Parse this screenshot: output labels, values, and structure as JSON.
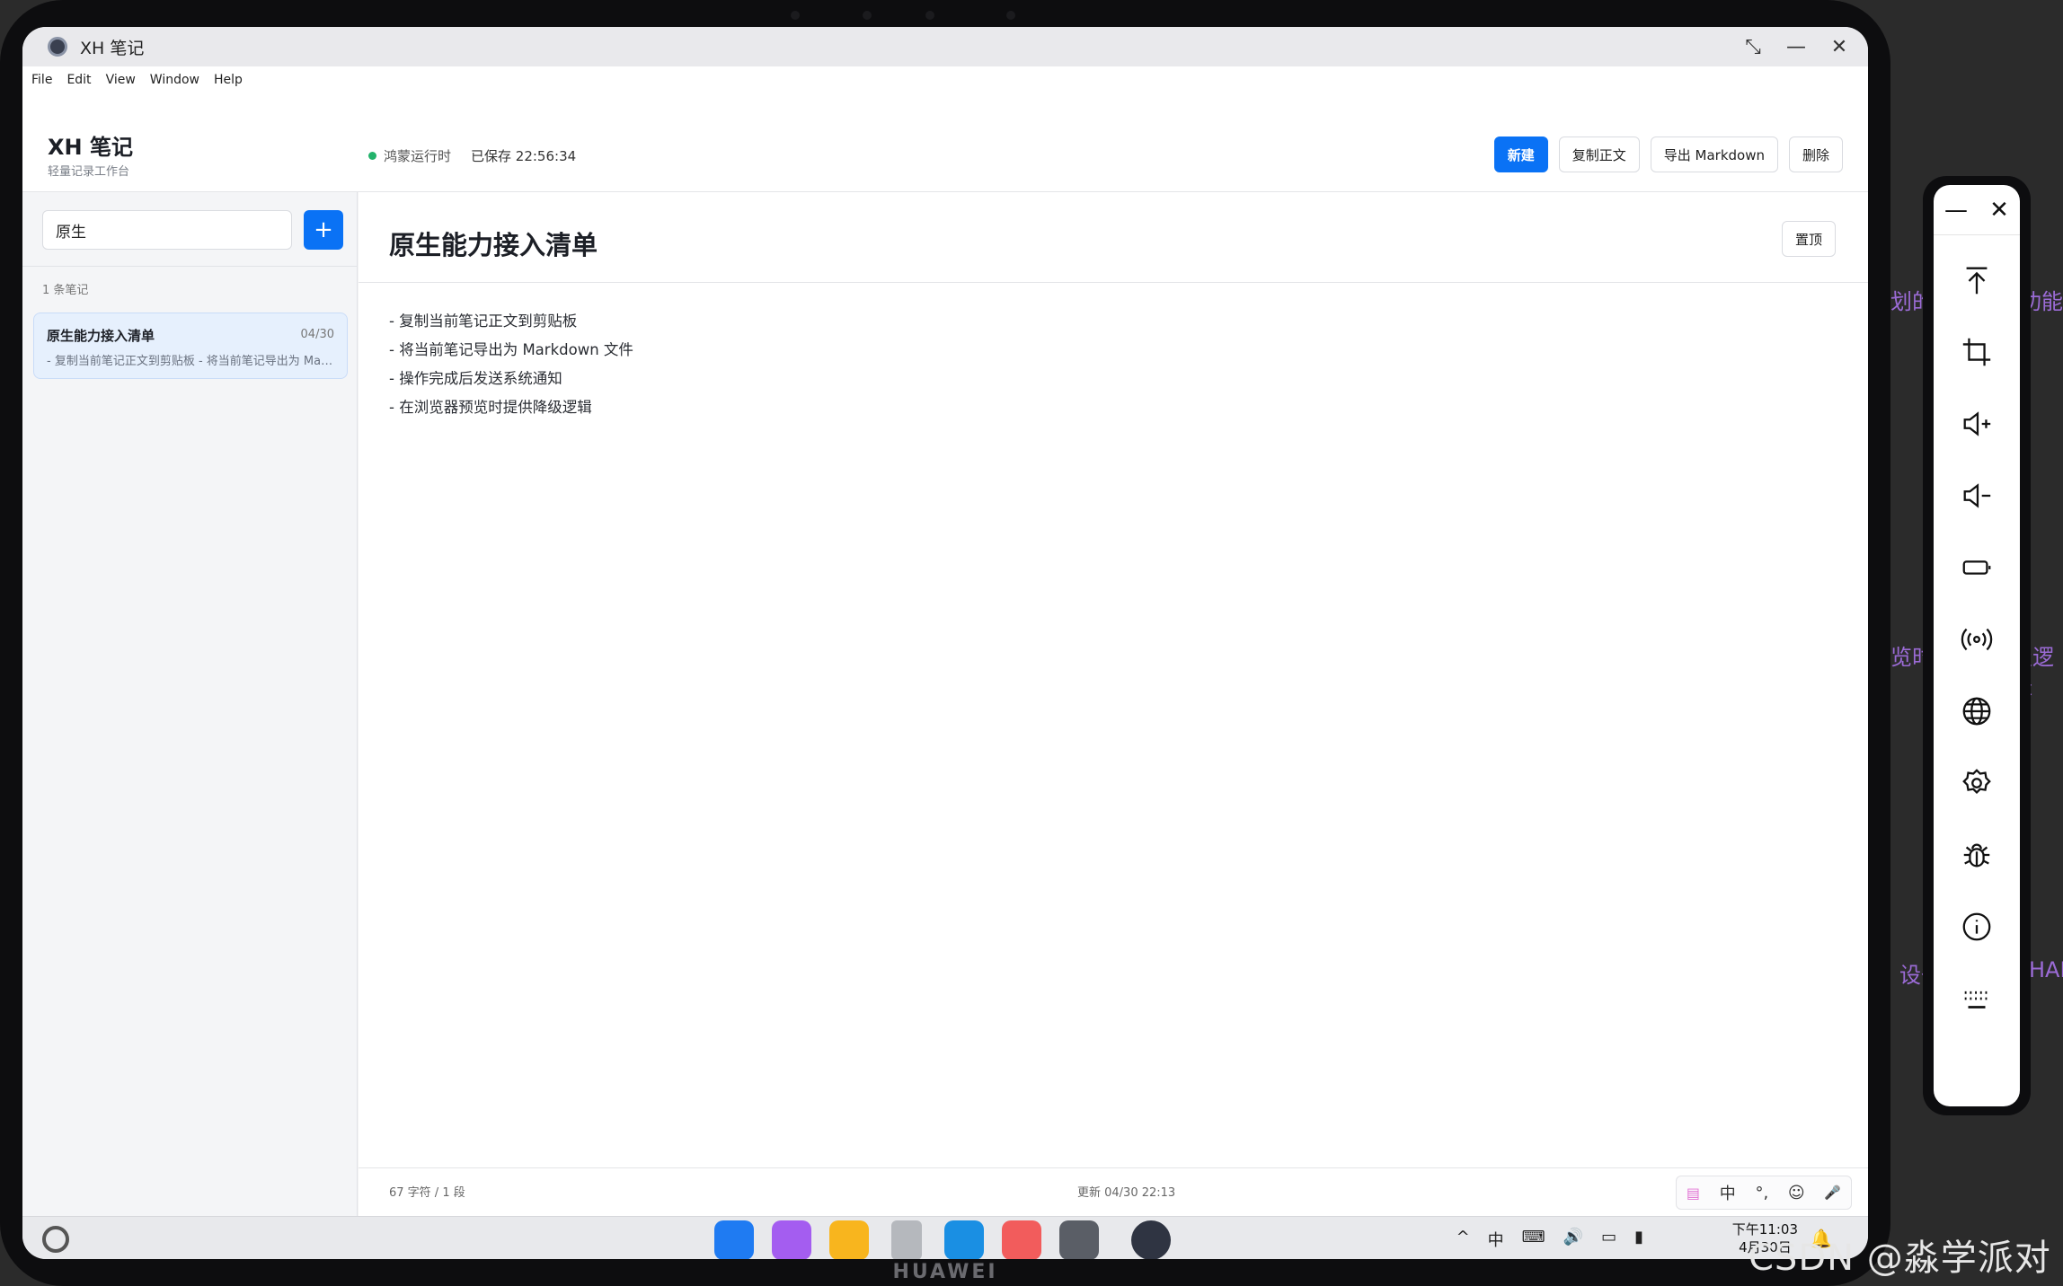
{
  "window": {
    "title": "XH 笔记",
    "controls": [
      "⤡",
      "—",
      "✕"
    ]
  },
  "menu": [
    "File",
    "Edit",
    "View",
    "Window",
    "Help"
  ],
  "header": {
    "app_name": "XH 笔记",
    "app_subtitle": "轻量记录工作台",
    "status": "鸿蒙运行时",
    "saved": "已保存 22:56:34",
    "actions": {
      "new": "新建",
      "copy": "复制正文",
      "export": "导出 Markdown",
      "delete": "删除"
    }
  },
  "sidebar": {
    "search_value": "原生",
    "add_label": "+",
    "count": "1 条笔记",
    "notes": [
      {
        "title": "原生能力接入清单",
        "date": "04/30",
        "snippet": "- 复制当前笔记正文到剪贴板 - 将当前笔记导出为 Markdown 文件"
      }
    ]
  },
  "editor": {
    "title": "原生能力接入清单",
    "pin_label": "置顶",
    "lines": [
      "- 复制当前笔记正文到剪贴板",
      "- 将当前笔记导出为 Markdown 文件",
      "- 操作完成后发送系统通知",
      "- 在浏览器预览时提供降级逻辑"
    ],
    "stats": "67 字符 / 1 段",
    "updated": "更新 04/30 22:13",
    "ime": [
      "中",
      "°,",
      "☺",
      "🎤"
    ]
  },
  "taskbar": {
    "dock": [
      {
        "name": "app-grid-icon",
        "color": "#1f7bf2"
      },
      {
        "name": "multitask-icon",
        "color": "#a45df0"
      },
      {
        "name": "files-icon",
        "color": "#f8b51e"
      },
      {
        "name": "trash-icon",
        "color": "#b5b8bd"
      },
      {
        "name": "browser-icon",
        "color": "#1a8fe3"
      },
      {
        "name": "gallery-icon",
        "color": "#f25c5c"
      },
      {
        "name": "settings-icon",
        "color": "#5a5e66"
      },
      {
        "name": "electron-app-icon",
        "color": "#2f3442"
      }
    ],
    "tray": [
      "^",
      "中",
      "⌨",
      "🔊",
      "▭",
      "▮"
    ],
    "time": "下午11:03",
    "date": "4月30日",
    "bell": "🔔"
  },
  "panel": {
    "top": [
      "—",
      "✕"
    ],
    "tools": [
      "upload-to-top-icon",
      "crop-icon",
      "volume-up-icon",
      "volume-down-icon",
      "battery-icon",
      "signal-icon",
      "globe-icon",
      "gear-icon",
      "bug-icon",
      "info-icon",
      "keyboard-icon"
    ]
  },
  "background_fragments": [
    "划的重",
    "功能",
    "览时",
    "级逻辑",
    "设备",
    "HAI"
  ],
  "device_brand": "HUAWEI",
  "watermark": "CSDN @淼学派对"
}
